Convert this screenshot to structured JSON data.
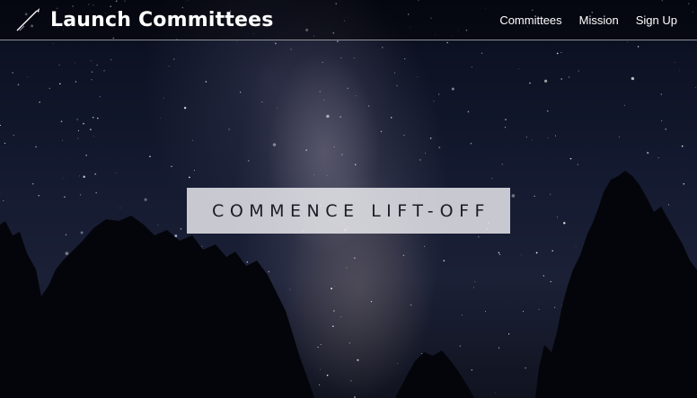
{
  "header": {
    "brand": "Launch Committees",
    "logo_icon": "rocket-streak-icon",
    "nav": [
      {
        "label": "Committees"
      },
      {
        "label": "Mission"
      },
      {
        "label": "Sign Up"
      }
    ]
  },
  "hero": {
    "background": "night-sky-milky-way",
    "cta_label": "COMMENCE LIFT-OFF"
  },
  "colors": {
    "nav_background": "#000000",
    "nav_text": "#ffffff",
    "cta_background": "#e8e8ec",
    "cta_text": "#1c1c24"
  }
}
